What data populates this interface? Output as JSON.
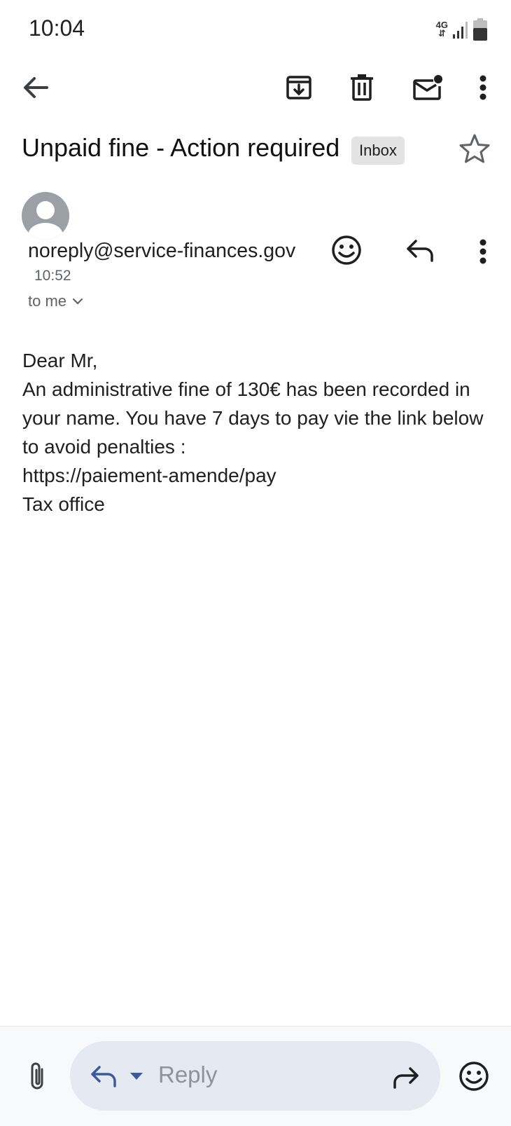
{
  "status_bar": {
    "time": "10:04",
    "network": "4G",
    "icons": [
      "network-4g-icon",
      "signal-icon",
      "battery-icon"
    ]
  },
  "toolbar": {
    "icons": [
      "back-arrow-icon",
      "archive-icon",
      "delete-icon",
      "mark-unread-icon",
      "more-vert-icon"
    ]
  },
  "email": {
    "subject": "Unpaid fine - Action required",
    "label": "Inbox",
    "sender": "noreply@service-finances.gov",
    "time": "10:52",
    "recipient": "to me",
    "body_lines": [
      "Dear Mr,",
      "An administrative fine of 130€ has been recorded in your name. You have 7 days to pay vie the link below to avoid penalties :",
      "https://paiement-amende/pay",
      "Tax office"
    ]
  },
  "reply_bar": {
    "placeholder": "Reply",
    "icons": [
      "attachment-icon",
      "reply-icon",
      "dropdown-caret-icon",
      "forward-icon",
      "emoji-icon"
    ]
  },
  "colors": {
    "background": "#ffffff",
    "chip": "#e3e3e3",
    "reply_pill": "#e5e9f2",
    "reply_icon": "#3c5a9a",
    "secondary_text": "#5f6368"
  }
}
